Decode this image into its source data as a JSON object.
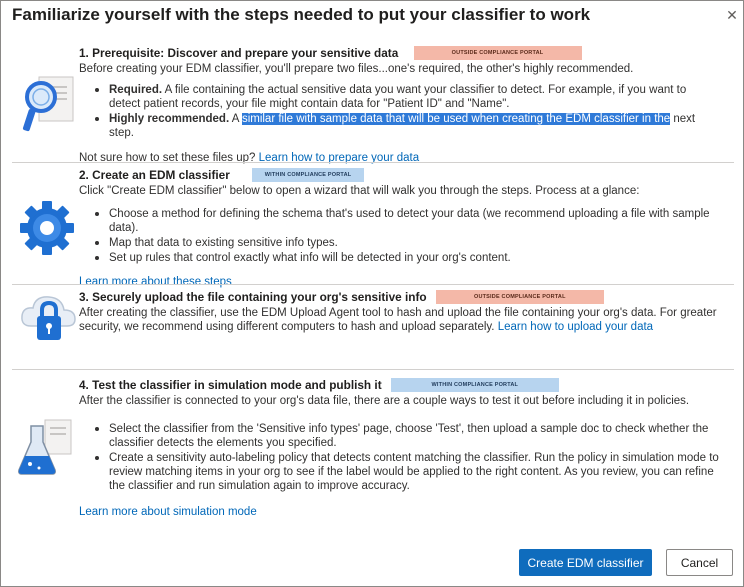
{
  "dialog": {
    "title": "Familiarize yourself with the steps needed to put your classifier to work",
    "close_icon": "close-icon"
  },
  "steps": [
    {
      "title": "1. Prerequisite: Discover and prepare your sensitive data",
      "tag": "OUTSIDE COMPLIANCE PORTAL",
      "icon": "magnifier-document-icon",
      "intro": "Before creating your EDM classifier, you'll prepare two files...one's required, the other's highly recommended.",
      "bullets": [
        {
          "bold": "Required.",
          "text": " A file containing the actual sensitive data you want your classifier to detect. For example, if you want to detect patient records, your file might contain data for \"Patient ID\" and \"Name\"."
        },
        {
          "bold": "Highly recommended.",
          "pre": " A ",
          "highlight": "similar file with sample data that will be used when creating the EDM classifier in the",
          "post": " next step."
        }
      ],
      "footer_text": "Not sure how to set these files up? ",
      "footer_link": "Learn how to prepare your data"
    },
    {
      "title": "2. Create an EDM classifier",
      "tag": "WITHIN COMPLIANCE PORTAL",
      "icon": "gear-icon",
      "intro": "Click \"Create EDM classifier\" below to open a wizard that will walk you through the steps. Process at a glance:",
      "bullets": [
        "Choose a method for defining the schema that's used to detect your data (we recommend uploading a file with sample data).",
        "Map that data to existing sensitive info types.",
        "Set up rules that control exactly what info will be detected in your org's content."
      ],
      "footer_link": "Learn more about these steps"
    },
    {
      "title": "3. Securely upload the file containing your org's sensitive info",
      "tag": "OUTSIDE COMPLIANCE PORTAL",
      "icon": "cloud-lock-icon",
      "intro": "After creating the classifier, use the EDM Upload Agent tool to hash and upload the file containing your org's data. For greater security, we recommend using different computers to hash and upload separately. ",
      "intro_link": "Learn how to upload your data"
    },
    {
      "title": "4. Test the classifier in simulation mode and publish it",
      "tag": "WITHIN COMPLIANCE PORTAL",
      "icon": "flask-icon",
      "intro": "After the classifier is connected to your org's data file, there are a couple ways to test it out before including it in policies.",
      "bullets": [
        "Select the classifier from the 'Sensitive info types' page, choose 'Test', then upload a sample doc to check whether the classifier detects the elements you specified.",
        "Create a sensitivity auto-labeling policy that detects content matching the classifier. Run the policy in simulation mode to review matching items in your org to see if the label would be applied to the right content. As you review, you can refine the classifier and run simulation again to improve accuracy."
      ],
      "footer_link": "Learn more about simulation mode"
    }
  ],
  "buttons": {
    "primary": "Create EDM classifier",
    "secondary": "Cancel"
  },
  "colors": {
    "accent": "#0f6cbd",
    "link": "#0067b8",
    "outside_tag": "#f4b8a8",
    "within_tag": "#b7d4ef",
    "selection": "#2f7ad8"
  }
}
